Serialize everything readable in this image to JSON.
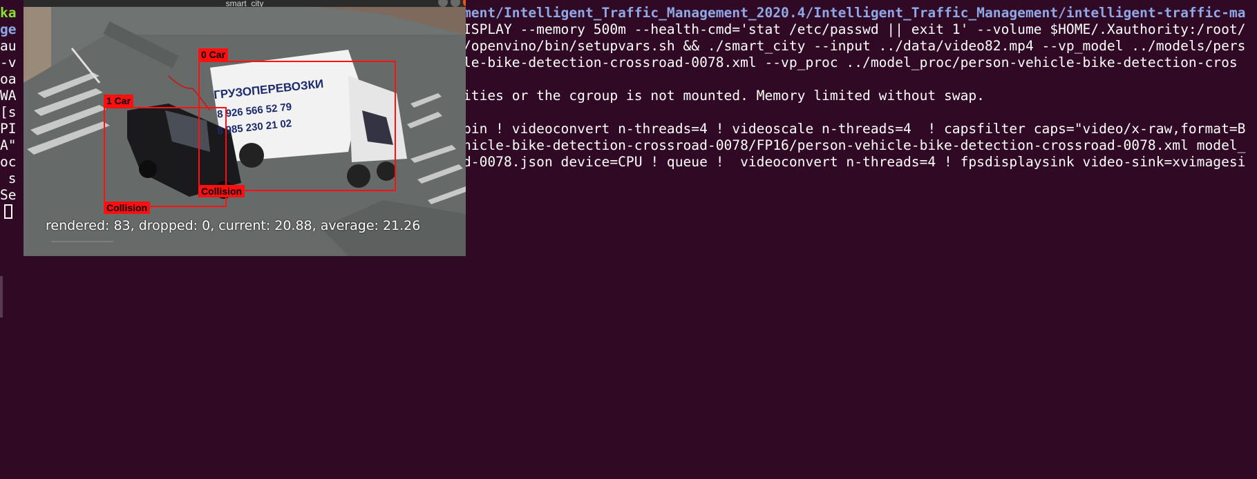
{
  "terminal": {
    "lines": [
      {
        "prefix": "ka",
        "prefix_hidden": "",
        "text": "ment/Intelligent_Traffic_Management_2020.4/Intelligent_Traffic_Management/intelligent-traffic-ma"
      },
      {
        "prefix": "ge",
        "text": "ISPLAY --memory 500m --health-cmd='stat /etc/passwd || exit 1' --volume $HOME/.Xauthority:/root/"
      },
      {
        "prefix": "au",
        "text": "/openvino/bin/setupvars.sh && ./smart_city --input ../data/video82.mp4 --vp_model ../models/pers"
      },
      {
        "prefix": "-v",
        "text": "le-bike-detection-crossroad-0078.xml --vp_proc ../model_proc/person-vehicle-bike-detection-cros"
      },
      {
        "prefix": "oa",
        "text": ""
      },
      {
        "prefix": "WA",
        "text": "ities or the cgroup is not mounted. Memory limited without swap."
      },
      {
        "prefix": "[s",
        "text": ""
      },
      {
        "prefix": "PI",
        "text": "bin ! videoconvert n-threads=4 ! videoscale n-threads=4  ! capsfilter caps=\"video/x-raw,format=B"
      },
      {
        "prefix": "A\"",
        "text": "hicle-bike-detection-crossroad-0078/FP16/person-vehicle-bike-detection-crossroad-0078.xml model_"
      },
      {
        "prefix": "oc",
        "text": "d-0078.json device=CPU ! queue !  videoconvert n-threads=4 ! fpsdisplaysink video-sink=xvimagesi"
      },
      {
        "prefix": " s",
        "text": ""
      },
      {
        "prefix": "Se",
        "text": ""
      }
    ]
  },
  "window": {
    "title": "smart_city"
  },
  "video": {
    "detections": [
      {
        "label": "0 Car"
      },
      {
        "label": "1 Car"
      }
    ],
    "collision_labels": [
      "Collision",
      "Collision"
    ],
    "truck_text": [
      "ГРУЗОПЕРЕВОЗКИ",
      "8 926 566 52 79",
      "8 985 230 21 02"
    ],
    "stats": "rendered: 83, dropped: 0, current: 20.88, average: 21.26"
  },
  "colors": {
    "terminal_bg": "#300a24",
    "path_blue": "#8fa8e6",
    "prompt_green": "#8ae234",
    "detection_red": "#ff1010"
  }
}
